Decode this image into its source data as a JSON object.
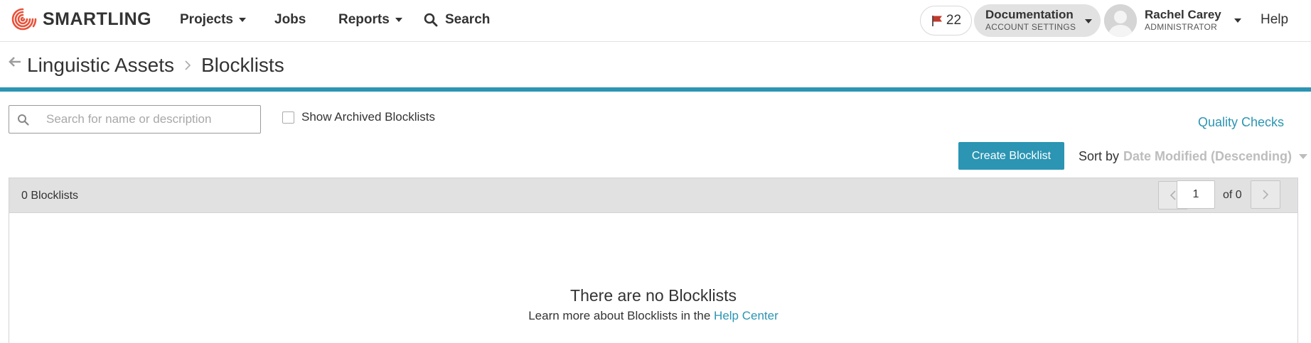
{
  "nav": {
    "logo_text": "SMARTLING",
    "projects": "Projects",
    "jobs": "Jobs",
    "reports": "Reports",
    "search": "Search",
    "flag_count": "22",
    "account": {
      "title": "Documentation",
      "subtitle": "ACCOUNT SETTINGS"
    },
    "user": {
      "name": "Rachel Carey",
      "role": "ADMINISTRATOR"
    },
    "help": "Help"
  },
  "breadcrumb": {
    "parent": "Linguistic Assets",
    "current": "Blocklists"
  },
  "toolbar": {
    "search_placeholder": "Search for name or description",
    "search_value": "",
    "show_archived_label": "Show Archived Blocklists",
    "show_archived_checked": false,
    "quality_checks_link": "Quality Checks",
    "create_button": "Create Blocklist",
    "sort_label": "Sort by",
    "sort_value": "Date Modified (Descending)"
  },
  "results": {
    "count_label": "0 Blocklists",
    "page_value": "1",
    "page_of": "of 0",
    "empty_title": "There are no Blocklists",
    "empty_text": "Learn more about Blocklists in the",
    "help_center_link": "Help Center"
  },
  "colors": {
    "accent": "#2b95b3",
    "logo_red": "#e8523a",
    "flag_red": "#c0392b"
  }
}
